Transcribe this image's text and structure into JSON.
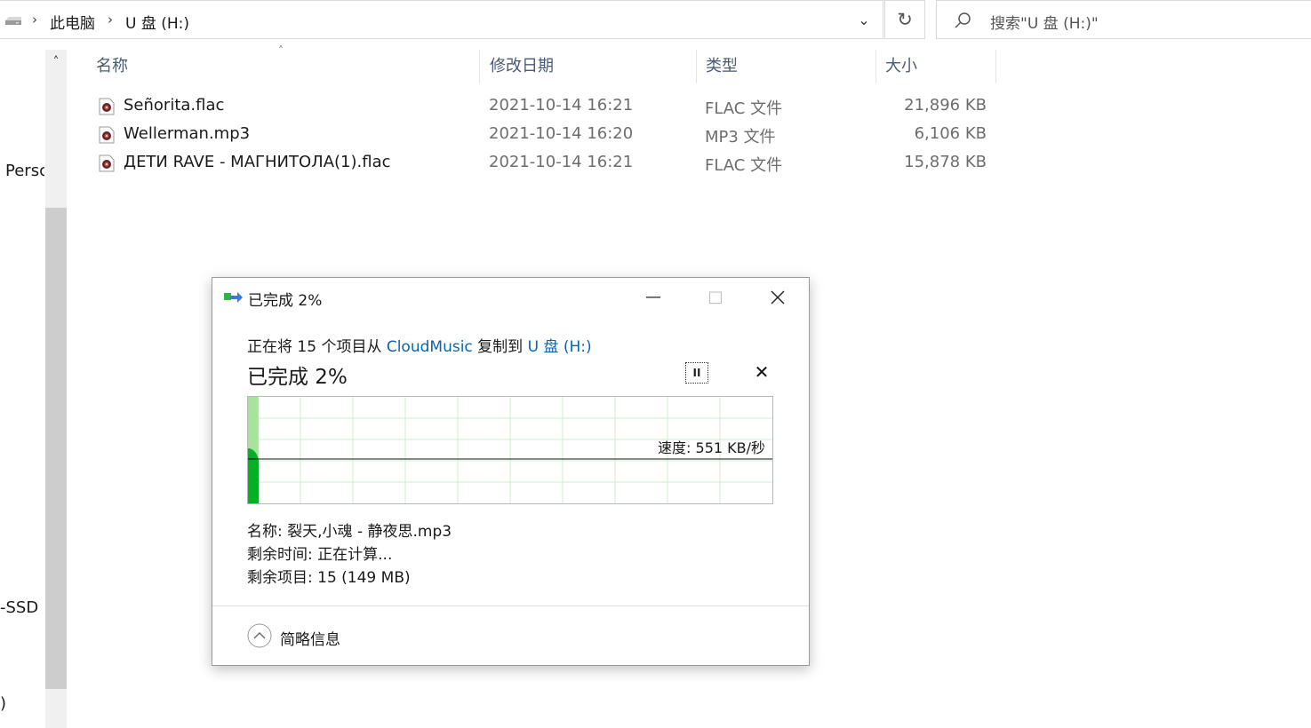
{
  "address": {
    "crumbs": [
      "此电脑",
      "U 盘 (H:)"
    ],
    "search_placeholder": "搜索\"U 盘 (H:)\""
  },
  "nav": {
    "items": [
      "Persc",
      "-SSD (",
      ")"
    ]
  },
  "columns": {
    "name": "名称",
    "date": "修改日期",
    "type": "类型",
    "size": "大小"
  },
  "files": [
    {
      "name": "Señorita.flac",
      "date": "2021-10-14 16:21",
      "type": "FLAC 文件",
      "size": "21,896 KB"
    },
    {
      "name": "Wellerman.mp3",
      "date": "2021-10-14 16:20",
      "type": "MP3 文件",
      "size": "6,106 KB"
    },
    {
      "name": "ДЕТИ RAVE - МАГНИТОЛА(1).flac",
      "date": "2021-10-14 16:21",
      "type": "FLAC 文件",
      "size": "15,878 KB"
    }
  ],
  "dialog": {
    "title": "已完成 2%",
    "desc_prefix": "正在将 15 个项目从 ",
    "source": "CloudMusic",
    "desc_mid": " 复制到 ",
    "destination": "U 盘 (H:)",
    "percent_text": "已完成 2%",
    "percent": 2,
    "pause_label": "II",
    "speed": "速度: 551 KB/秒",
    "name_line": "名称:  裂天,小魂 - 静夜思.mp3",
    "time_line": "剩余时间:  正在计算...",
    "items_line": "剩余项目:  15 (149 MB)",
    "collapse_label": "简略信息",
    "colors": {
      "progress_fill": "#a8e39b",
      "transfer_fill": "#06b025",
      "grid": "#cfeecd",
      "link": "#0a64b4"
    }
  }
}
